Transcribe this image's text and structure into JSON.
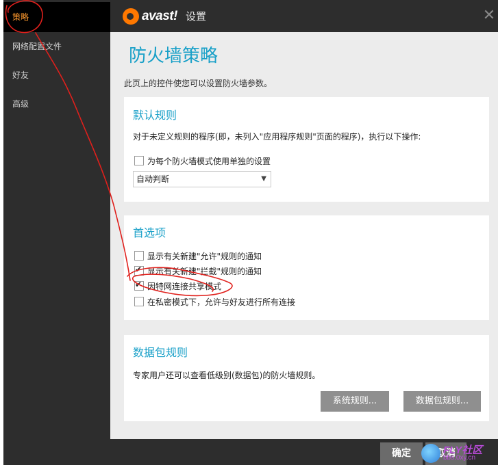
{
  "sidebar": {
    "items": [
      {
        "label": "策略",
        "active": true
      },
      {
        "label": "网络配置文件",
        "active": false
      },
      {
        "label": "好友",
        "active": false
      },
      {
        "label": "高级",
        "active": false
      }
    ]
  },
  "titlebar": {
    "logo_text": "avast!",
    "title": "设置",
    "close_icon": "close-icon"
  },
  "main": {
    "page_title": "防火墙策略",
    "page_desc": "此页上的控件使您可以设置防火墙参数。"
  },
  "default_rules": {
    "title": "默认规则",
    "description": "对于未定义规则的程序(即，未列入\"应用程序规则\"页面的程序)，执行以下操作:",
    "checkbox_label": "为每个防火墙模式使用单独的设置",
    "checkbox_checked": false,
    "select_value": "自动判断"
  },
  "preferences": {
    "title": "首选项",
    "options": [
      {
        "label": "显示有关新建\"允许\"规则的通知",
        "checked": false
      },
      {
        "label": "显示有关新建\"拦截\"规则的通知",
        "checked": true
      },
      {
        "label": "因特网连接共享模式",
        "checked": true
      },
      {
        "label": "在私密模式下，允许与好友进行所有连接",
        "checked": false
      }
    ]
  },
  "packet_rules": {
    "title": "数据包规则",
    "description": "专家用户还可以查看低级别(数据包)的防火墙规则。",
    "system_rules_button": "系统规则...",
    "packet_rules_button": "数据包规则..."
  },
  "footer": {
    "ok_button": "确定",
    "cancel_button": "取消",
    "watermark_main": "FLY社区",
    "watermark_sub": "bbs.0xy.cn"
  },
  "colors": {
    "accent": "#19a0c8",
    "active_sidebar": "#ff9a2e",
    "annotation": "#e0201c"
  }
}
